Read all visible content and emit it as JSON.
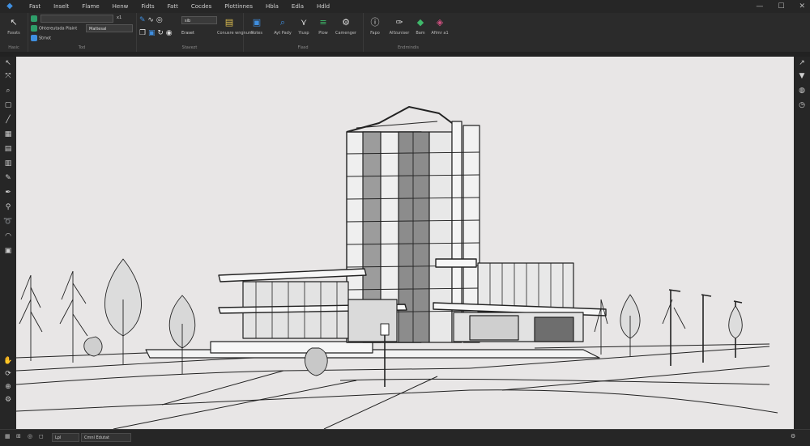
{
  "menu": [
    "Fast",
    "Inselt",
    "Flame",
    "Henw",
    "Fidts",
    "Fatt",
    "Cocdes",
    "Plottinnes",
    "Hbla",
    "Edla",
    "Hdld"
  ],
  "ribbon": {
    "modify": {
      "label": "Fossts",
      "group": "Hasic"
    },
    "layer_combo": "",
    "layer_combo_suffix": "x1",
    "layer_state": "Ohtereutada Plaint",
    "shade": "Stmot",
    "match": "Mattesal",
    "layers_group": "Tod",
    "font_size": "sib",
    "erase": "Eraset",
    "attach": "Conusre wngnurn",
    "annotate_group": "Stavezt",
    "paste": "Rotes",
    "pan": "Ayt Pady",
    "split": "Yiusp",
    "flow": "Plow",
    "compare": "Camenger",
    "edit_group": "Flasd",
    "pause": "Fapo",
    "annotation": "Alfzuniser",
    "base": "Bam",
    "view": "Afimr a1",
    "insert_group": "Endmindis"
  },
  "status": {
    "tab": "Lpl",
    "coord": "Cmnl Edutat"
  },
  "colors": {
    "accent": "#3f8fe0",
    "canvas": "#e8e6e6",
    "chrome": "#262626",
    "ribbon": "#2b2b2b"
  }
}
